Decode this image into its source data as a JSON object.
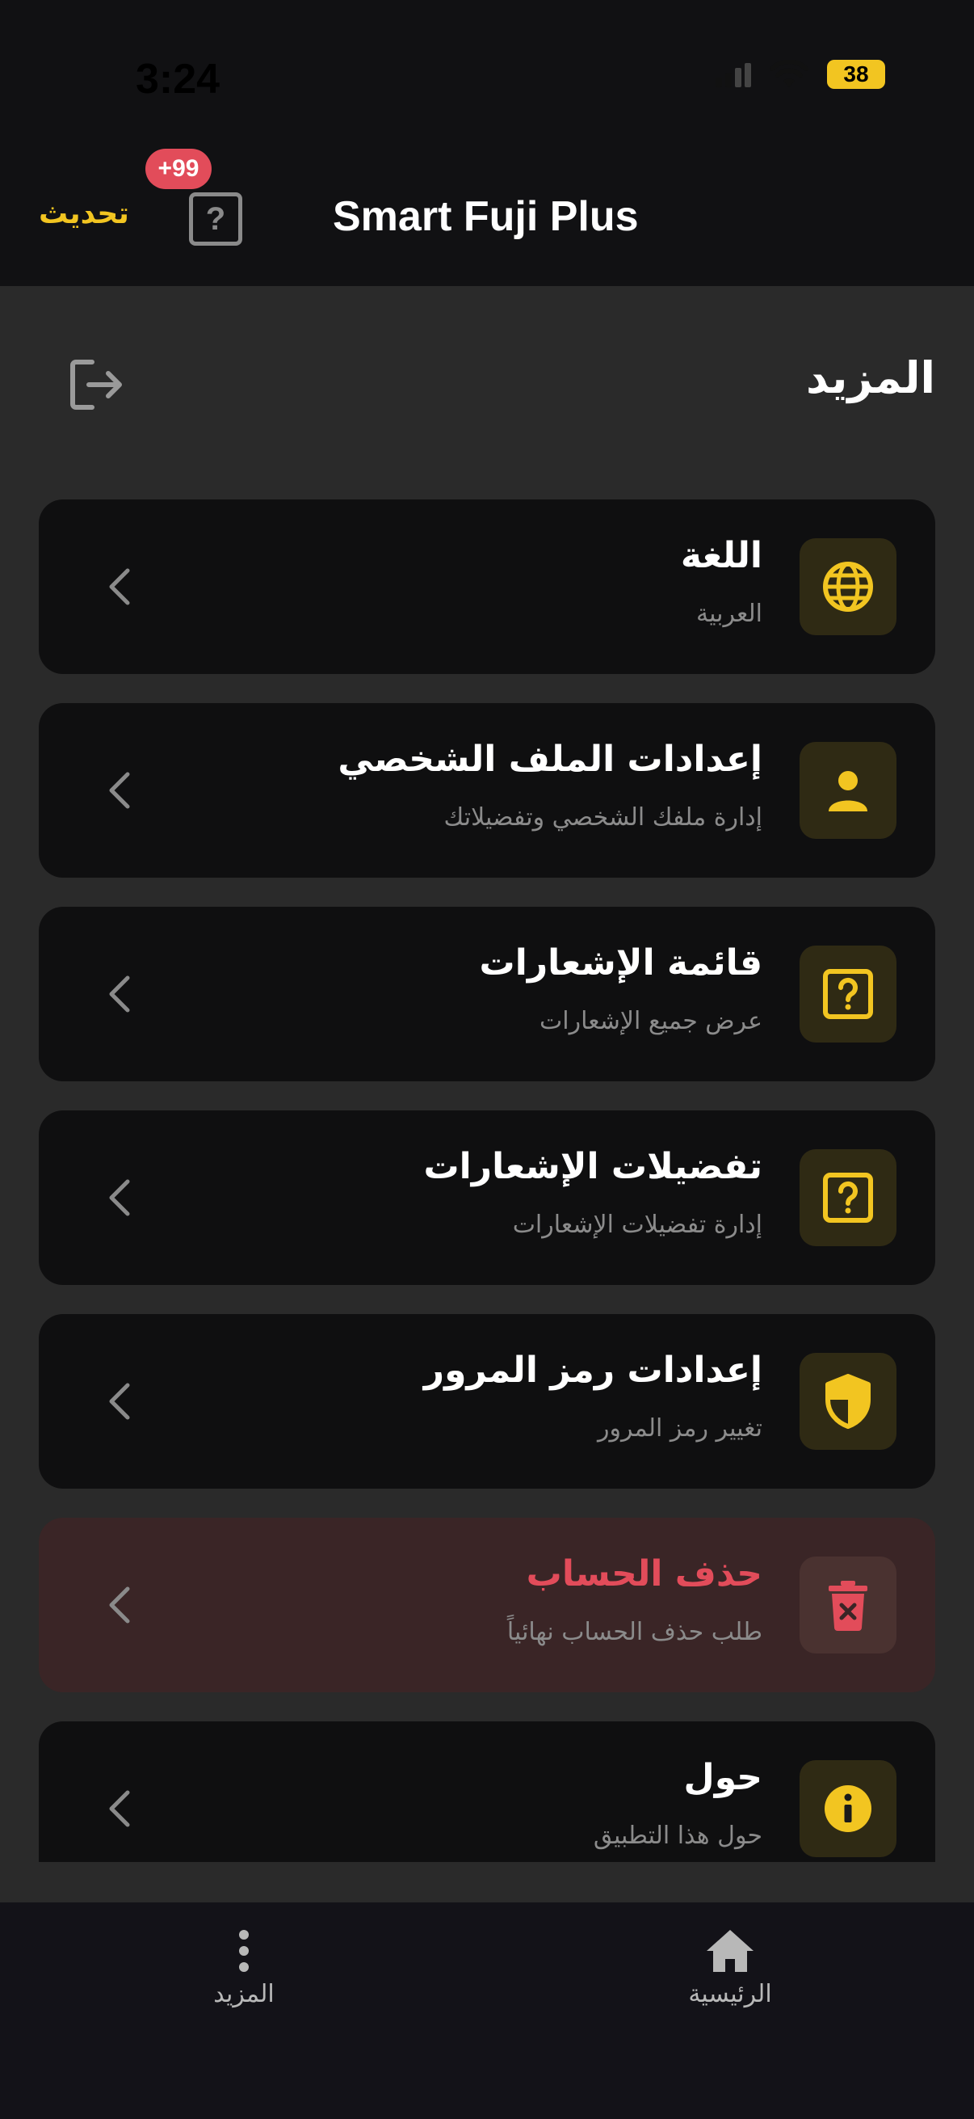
{
  "status_bar": {
    "time": "3:24",
    "battery": "38"
  },
  "header": {
    "title": "Smart Fuji Plus",
    "update_label": "تحديث",
    "help_symbol": "?",
    "badge": "+99"
  },
  "page": {
    "title": "المزيد"
  },
  "menu_items": [
    {
      "title": "اللغة",
      "subtitle": "العربية",
      "icon": "globe-icon"
    },
    {
      "title": "إعدادات الملف الشخصي",
      "subtitle": "إدارة ملفك الشخصي وتفضيلاتك",
      "icon": "person-icon"
    },
    {
      "title": "قائمة الإشعارات",
      "subtitle": "عرض جميع الإشعارات",
      "icon": "question-square-icon"
    },
    {
      "title": "تفضيلات الإشعارات",
      "subtitle": "إدارة تفضيلات الإشعارات",
      "icon": "question-square-icon"
    },
    {
      "title": "إعدادات رمز المرور",
      "subtitle": "تغيير رمز المرور",
      "icon": "shield-icon"
    },
    {
      "title": "حذف الحساب",
      "subtitle": "طلب حذف الحساب نهائياً",
      "icon": "trash-icon"
    },
    {
      "title": "حول",
      "subtitle": "حول هذا التطبيق",
      "icon": "info-icon"
    }
  ],
  "bottom_nav": [
    {
      "label": "المزيد",
      "icon": "more-vertical-icon"
    },
    {
      "label": "الرئيسية",
      "icon": "home-icon"
    }
  ],
  "colors": {
    "accent": "#f2c521",
    "danger": "#e24c5a",
    "card_bg": "#0f0f10",
    "page_bg": "#2a2a2a"
  }
}
